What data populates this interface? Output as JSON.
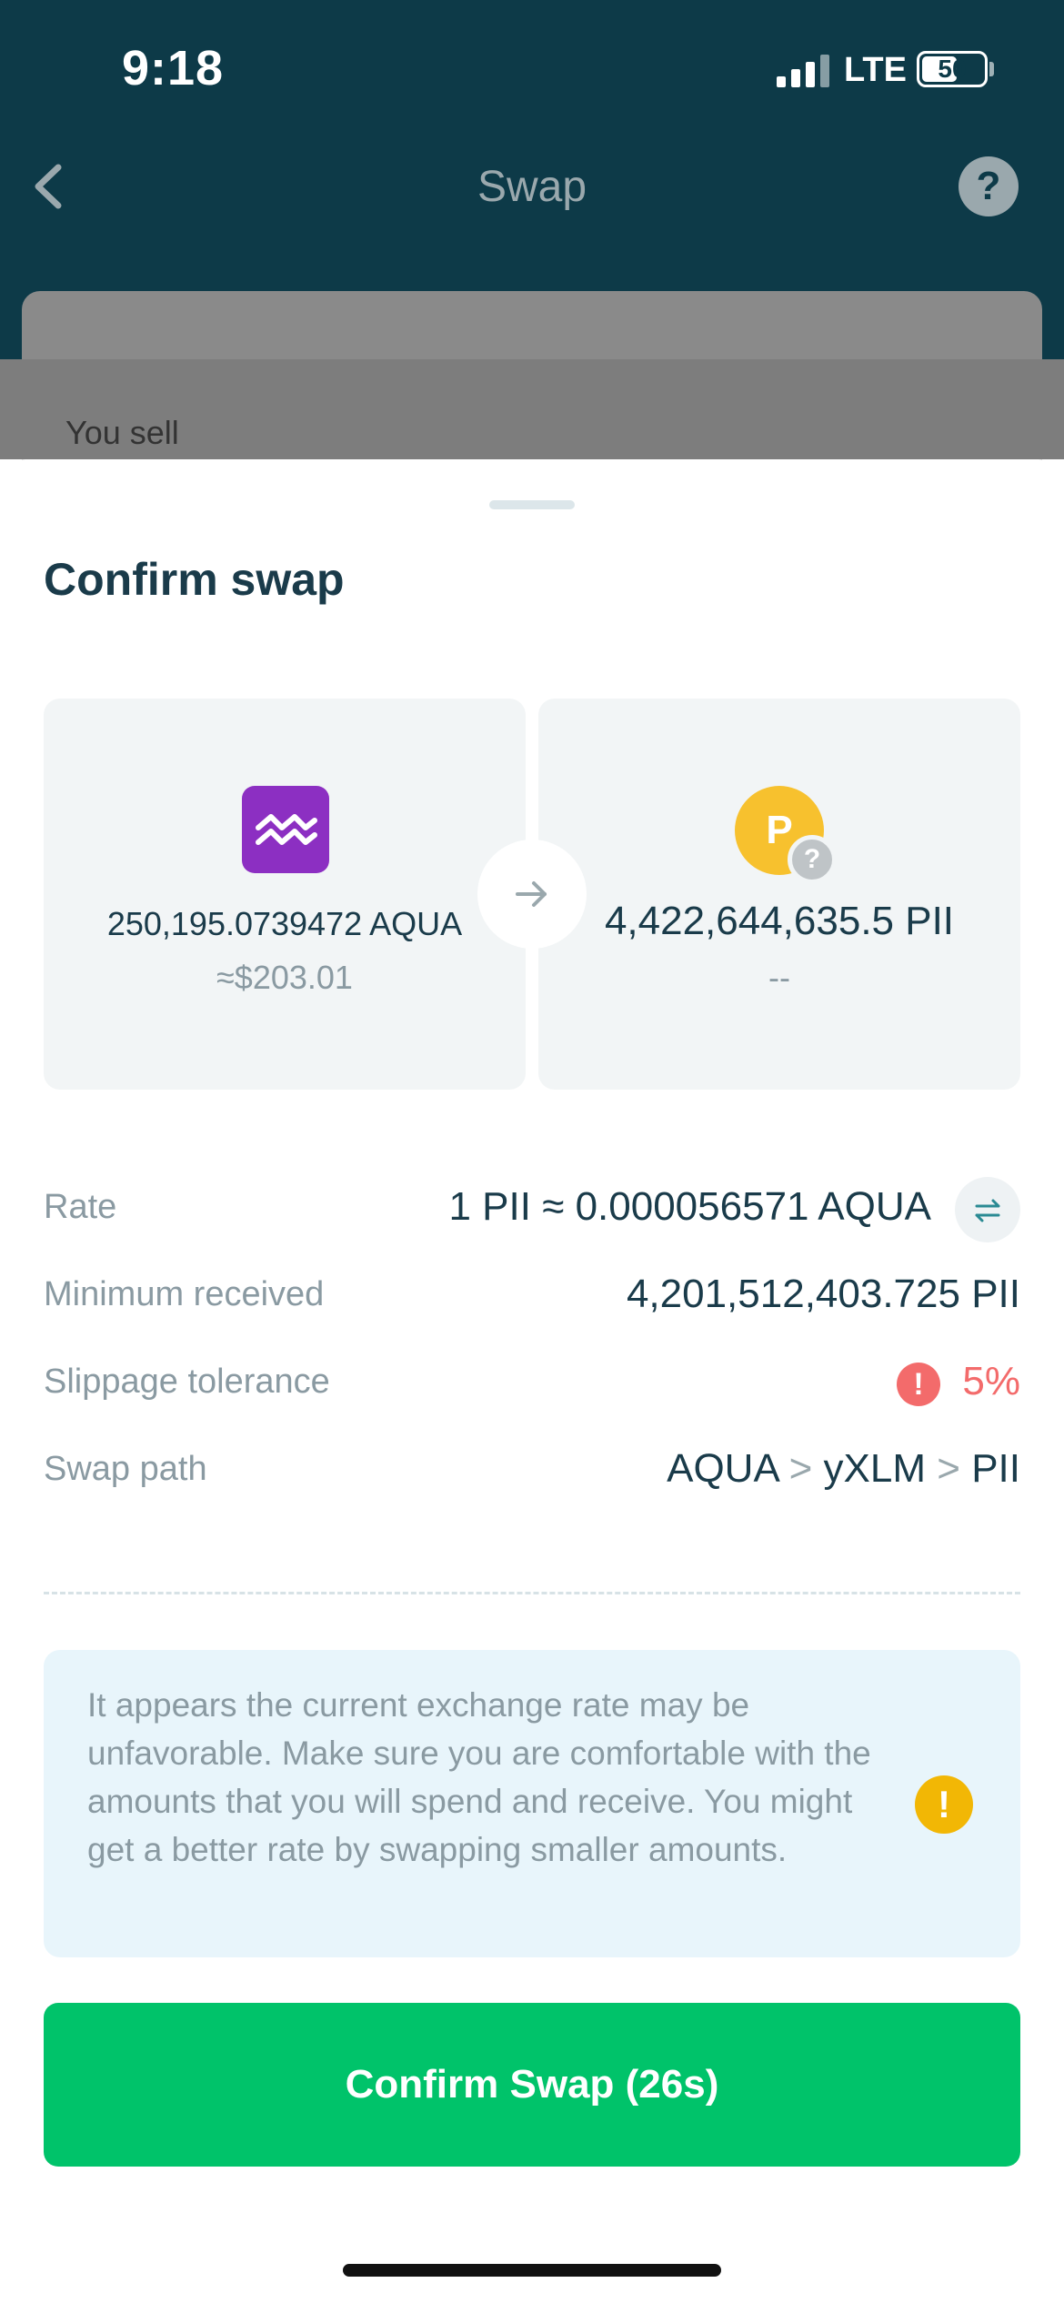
{
  "status_bar": {
    "time": "9:18",
    "network": "LTE",
    "battery": "50"
  },
  "nav": {
    "title": "Swap",
    "back_icon": "chevron-left-icon",
    "help_label": "?"
  },
  "background": {
    "you_sell_label": "You sell"
  },
  "sheet": {
    "title": "Confirm swap",
    "sell": {
      "asset_icon": "aqua-logo-icon",
      "amount": "250,195.0739472 AQUA",
      "usd_value": "≈$203.01"
    },
    "buy": {
      "asset_logo_letter": "P",
      "unknown_badge": "?",
      "amount": "4,422,644,635.5 PII",
      "usd_value": "--"
    },
    "details": {
      "rate": {
        "label": "Rate",
        "value": "1 PII ≈ 0.000056571 AQUA"
      },
      "minimum_received": {
        "label": "Minimum received",
        "value": "4,201,512,403.725 PII"
      },
      "slippage": {
        "label": "Slippage tolerance",
        "icon": "!",
        "value": "5%"
      },
      "swap_path": {
        "label": "Swap path",
        "steps": [
          "AQUA",
          "yXLM",
          "PII"
        ],
        "separator": ">"
      }
    },
    "warning": {
      "text": "It appears the current exchange rate may be unfavorable. Make sure you are comfortable with the amounts that you will spend and receive. You might get a better rate by swapping smaller amounts.",
      "icon": "!"
    },
    "confirm_button": "Confirm Swap (26s)"
  },
  "colors": {
    "header_bg": "#0d3a48",
    "primary_text": "#1a3b4a",
    "muted_text": "#8a9aa2",
    "confirm_green": "#00c36a",
    "danger": "#f36b6b",
    "warning_yellow": "#f2b705",
    "aqua_purple": "#8c2fc2",
    "pii_yellow": "#f7c12e"
  }
}
